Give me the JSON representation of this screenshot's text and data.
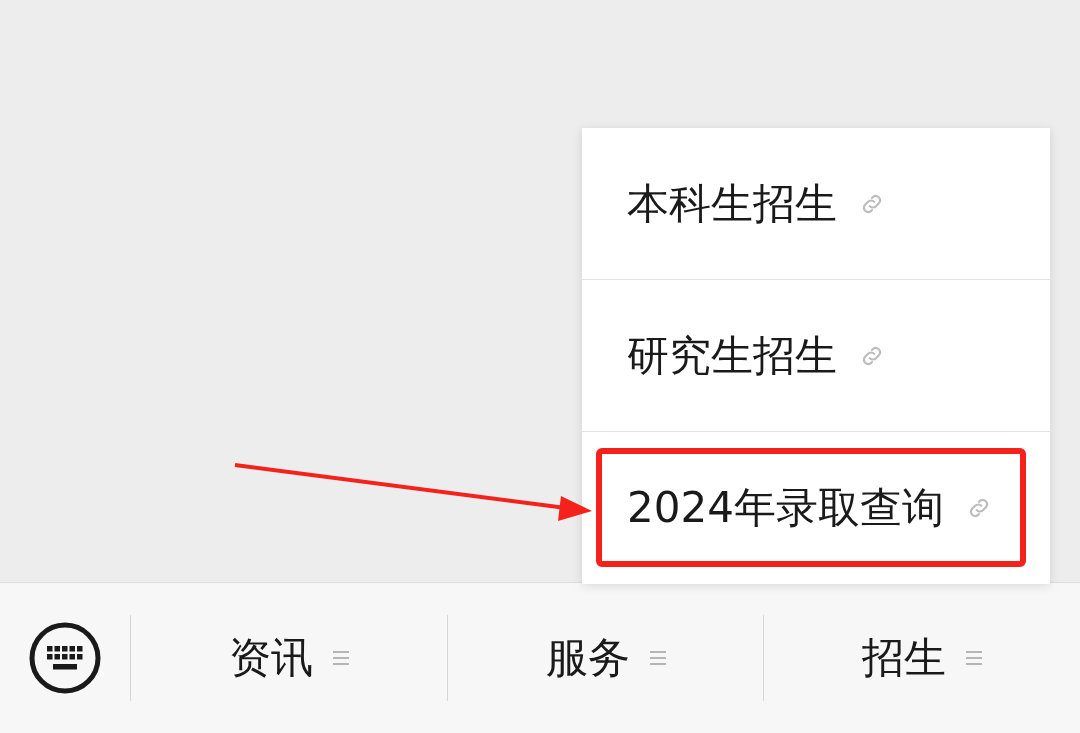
{
  "popup_menu": {
    "items": [
      {
        "label": "本科生招生",
        "highlighted": false
      },
      {
        "label": "研究生招生",
        "highlighted": false
      },
      {
        "label": "2024年录取查询",
        "highlighted": true
      }
    ]
  },
  "bottom_menu": {
    "tabs": [
      {
        "label": "资讯"
      },
      {
        "label": "服务"
      },
      {
        "label": "招生"
      }
    ]
  }
}
